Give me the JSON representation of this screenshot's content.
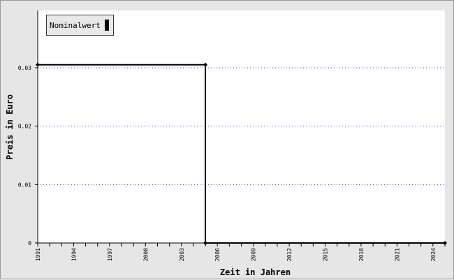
{
  "chart_data": {
    "type": "line",
    "xlabel": "Zeit in Jahren",
    "ylabel": "Preis in Euro",
    "xlim": [
      1991,
      2025
    ],
    "ylim": [
      0,
      0.04
    ],
    "x_ticks": [
      "1991",
      "1994",
      "1997",
      "2000",
      "2003",
      "2006",
      "2009",
      "2012",
      "2015",
      "2018",
      "2021",
      "2024"
    ],
    "y_ticks": [
      "0",
      "0.01",
      "0.02",
      "0.03"
    ],
    "grid": "horizontal dotted",
    "legend_position": "top-left",
    "series": [
      {
        "name": "Nominalwert",
        "color": "#000000",
        "points": [
          [
            1991,
            0.0305
          ],
          [
            2005,
            0.0305
          ],
          [
            2005,
            0
          ],
          [
            2025,
            0
          ]
        ]
      }
    ]
  }
}
